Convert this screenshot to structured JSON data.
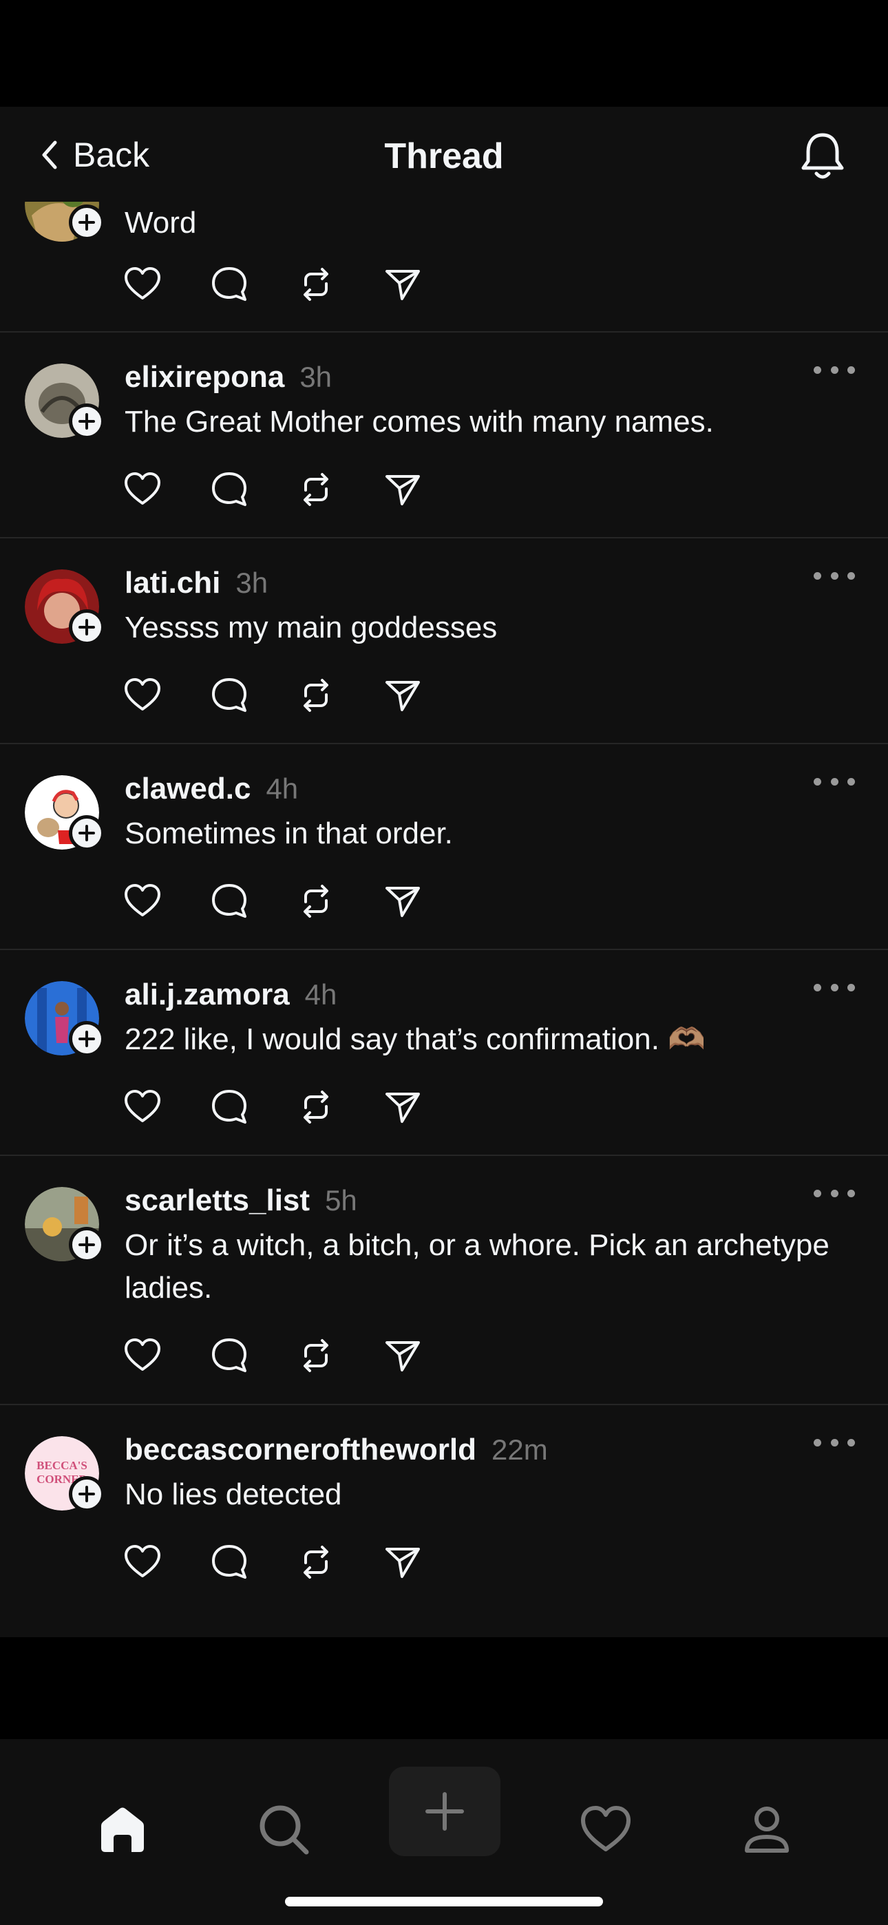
{
  "nav": {
    "back_label": "Back",
    "title": "Thread",
    "back_icon": "chevron-left-icon",
    "bell_icon": "bell-icon"
  },
  "posts": [
    {
      "username": "",
      "time": "",
      "text": "Word"
    },
    {
      "username": "elixirepona",
      "time": "3h",
      "text": "The Great Mother comes with many names."
    },
    {
      "username": "lati.chi",
      "time": "3h",
      "text": "Yessss my main goddesses"
    },
    {
      "username": "clawed.c",
      "time": "4h",
      "text": "Sometimes in that order."
    },
    {
      "username": "ali.j.zamora",
      "time": "4h",
      "text": "222 like, I would say that’s confirmation. 🫶🏽"
    },
    {
      "username": "scarletts_list",
      "time": "5h",
      "text": "Or it’s a witch, a bitch, or a whore. Pick an archetype ladies."
    },
    {
      "username": "beccascorneroftheworld",
      "time": "22m",
      "text": "No lies detected",
      "avatar_text": "BECCA'S CORNER"
    }
  ],
  "action_icons": [
    "heart-icon",
    "comment-icon",
    "repost-icon",
    "share-icon"
  ],
  "tab_bar": [
    "home-icon",
    "search-icon",
    "create-plus-icon",
    "activity-heart-icon",
    "profile-icon"
  ],
  "colors": {
    "background": "#101010",
    "text": "#f3f5f7",
    "muted": "#777777",
    "divider": "#262626"
  }
}
